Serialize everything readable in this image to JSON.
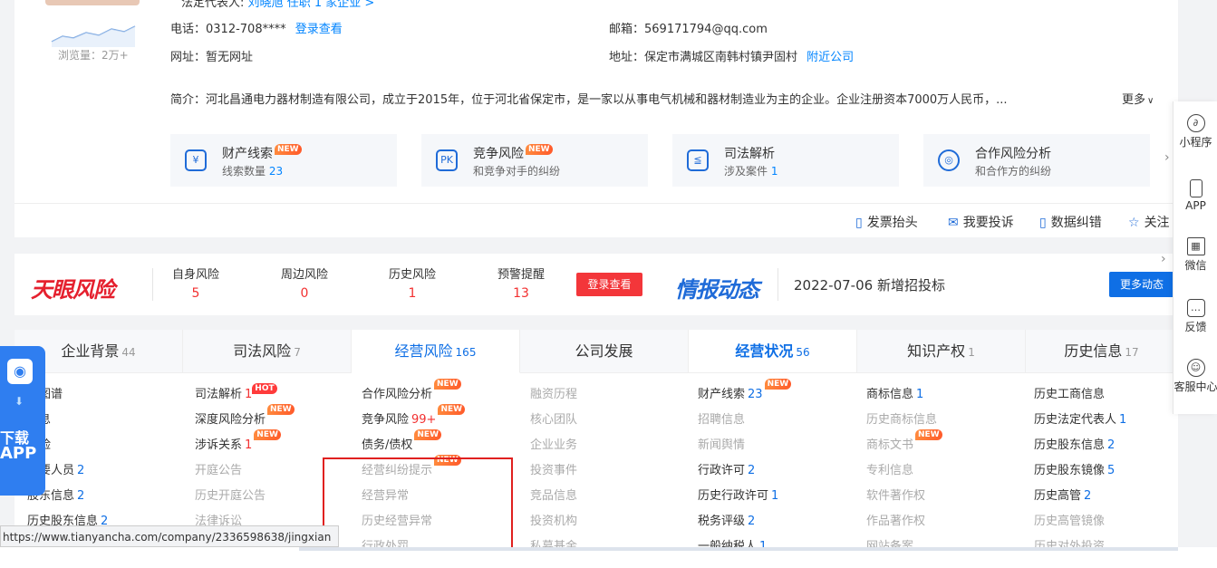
{
  "top": {
    "legal_rep_label": "法定代表人:",
    "legal_rep_name": "刘晓旭",
    "legal_rep_suffix": "任职 1 家企业 >",
    "views": "浏览量：2万+",
    "phone_label": "电话：",
    "phone": "0312-708****",
    "phone_link": "登录查看",
    "email_label": "邮箱：",
    "email": "569171794@qq.com",
    "site_label": "网址：",
    "site": "暂无网址",
    "address_label": "地址：",
    "address": "保定市满城区南韩村镇尹固村",
    "nearby_link": "附近公司",
    "intro": "简介：河北昌通电力器材制造有限公司，成立于2015年，位于河北省保定市，是一家以从事电气机械和器材制造业为主的企业。企业注册资本7000万人民币，...",
    "more": "更多",
    "features": [
      {
        "icon": "¥",
        "title": "财产线索",
        "tag": "NEW",
        "sub_prefix": "线索数量",
        "sub_num": "23"
      },
      {
        "icon": "PK",
        "title": "竞争风险",
        "tag": "NEW",
        "sub_prefix": "和竞争对手的纠纷",
        "sub_num": ""
      },
      {
        "icon": "≦",
        "title": "司法解析",
        "tag": "",
        "sub_prefix": "涉及案件",
        "sub_num": "1"
      },
      {
        "icon": "◎",
        "title": "合作风险分析",
        "tag": "",
        "sub_prefix": "和合作方的纠纷",
        "sub_num": ""
      }
    ],
    "actions": [
      "发票抬头",
      "我要投诉",
      "数据纠错",
      "关注"
    ]
  },
  "risk": {
    "logo": "天眼风险",
    "cols": [
      {
        "label": "自身风险",
        "value": "5"
      },
      {
        "label": "周边风险",
        "value": "0"
      },
      {
        "label": "历史风险",
        "value": "1"
      },
      {
        "label": "预警提醒",
        "value": "13"
      }
    ],
    "login_button": "登录查看",
    "intel_logo": "情报动态",
    "intel_text": "2022-07-06   新增招投标",
    "more_button": "更多动态"
  },
  "tabs": [
    {
      "label": "企业背景",
      "count": "44"
    },
    {
      "label": "司法风险",
      "count": "7"
    },
    {
      "label": "经营风险",
      "count": "165"
    },
    {
      "label": "公司发展",
      "count": ""
    },
    {
      "label": "经营状况",
      "count": "56"
    },
    {
      "label": "知识产权",
      "count": "1"
    },
    {
      "label": "历史信息",
      "count": "17"
    }
  ],
  "columns": [
    [
      {
        "text": "眼图谱",
        "num": "",
        "tag": ""
      },
      {
        "text": "信息",
        "num": "",
        "tag": ""
      },
      {
        "text": "风险",
        "num": "",
        "tag": ""
      },
      {
        "text": "主要人员",
        "num": "2",
        "tag": ""
      },
      {
        "text": "股东信息",
        "num": "2",
        "tag": ""
      },
      {
        "text": "历史股东信息",
        "num": "2",
        "tag": ""
      }
    ],
    [
      {
        "text": "司法解析",
        "num": "1",
        "tag": "HOT",
        "numred": true
      },
      {
        "text": "深度风险分析",
        "num": "",
        "tag": "NEW"
      },
      {
        "text": "涉诉关系",
        "num": "1",
        "tag": "NEW",
        "numred": true
      },
      {
        "text": "开庭公告",
        "num": "",
        "tag": "",
        "dim": true
      },
      {
        "text": "历史开庭公告",
        "num": "",
        "tag": "",
        "dim": true
      },
      {
        "text": "法律诉讼",
        "num": "",
        "tag": "",
        "dim": true
      }
    ],
    [
      {
        "text": "合作风险分析",
        "num": "",
        "tag": "NEW"
      },
      {
        "text": "竞争风险",
        "num": "99+",
        "tag": "NEW",
        "numred": true
      },
      {
        "text": "债务/债权",
        "num": "",
        "tag": "NEW"
      },
      {
        "text": "经营纠纷提示",
        "num": "",
        "tag": "NEW",
        "dim": true
      },
      {
        "text": "经营异常",
        "num": "",
        "tag": "",
        "dim": true
      },
      {
        "text": "历史经营异常",
        "num": "",
        "tag": "",
        "dim": true
      },
      {
        "text": "行政处罚",
        "num": "",
        "tag": "",
        "dim": true
      }
    ],
    [
      {
        "text": "融资历程",
        "num": "",
        "tag": "",
        "dim": true
      },
      {
        "text": "核心团队",
        "num": "",
        "tag": "",
        "dim": true
      },
      {
        "text": "企业业务",
        "num": "",
        "tag": "",
        "dim": true
      },
      {
        "text": "投资事件",
        "num": "",
        "tag": "",
        "dim": true
      },
      {
        "text": "竞品信息",
        "num": "",
        "tag": "",
        "dim": true
      },
      {
        "text": "投资机构",
        "num": "",
        "tag": "",
        "dim": true
      },
      {
        "text": "私募基金",
        "num": "",
        "tag": "",
        "dim": true
      }
    ],
    [
      {
        "text": "财产线索",
        "num": "23",
        "tag": "NEW"
      },
      {
        "text": "招聘信息",
        "num": "",
        "tag": "",
        "dim": true
      },
      {
        "text": "新闻舆情",
        "num": "",
        "tag": "",
        "dim": true
      },
      {
        "text": "行政许可",
        "num": "2",
        "tag": ""
      },
      {
        "text": "历史行政许可",
        "num": "1",
        "tag": ""
      },
      {
        "text": "税务评级",
        "num": "2",
        "tag": ""
      },
      {
        "text": "一般纳税人",
        "num": "1",
        "tag": ""
      }
    ],
    [
      {
        "text": "商标信息",
        "num": "1",
        "tag": ""
      },
      {
        "text": "历史商标信息",
        "num": "",
        "tag": "",
        "dim": true
      },
      {
        "text": "商标文书",
        "num": "",
        "tag": "NEW",
        "dim": true
      },
      {
        "text": "专利信息",
        "num": "",
        "tag": "",
        "dim": true
      },
      {
        "text": "软件著作权",
        "num": "",
        "tag": "",
        "dim": true
      },
      {
        "text": "作品著作权",
        "num": "",
        "tag": "",
        "dim": true
      },
      {
        "text": "网站备案",
        "num": "",
        "tag": "",
        "dim": true
      }
    ],
    [
      {
        "text": "历史工商信息",
        "num": "",
        "tag": ""
      },
      {
        "text": "历史法定代表人",
        "num": "1",
        "tag": ""
      },
      {
        "text": "历史股东信息",
        "num": "2",
        "tag": ""
      },
      {
        "text": "历史股东镜像",
        "num": "5",
        "tag": ""
      },
      {
        "text": "历史高管",
        "num": "2",
        "tag": ""
      },
      {
        "text": "历史高管镜像",
        "num": "",
        "tag": "",
        "dim": true
      },
      {
        "text": "历史对外投资",
        "num": "",
        "tag": "",
        "dim": true
      }
    ]
  ],
  "download": {
    "line1": "下载",
    "line2": "APP"
  },
  "sidebar": [
    {
      "icon": "mini-program-icon",
      "label": "小程序"
    },
    {
      "icon": "phone-icon",
      "label": "APP"
    },
    {
      "icon": "qr-code-icon",
      "label": "微信"
    },
    {
      "icon": "feedback-icon",
      "label": "反馈"
    },
    {
      "icon": "customer-service-icon",
      "label": "客服中心"
    }
  ],
  "status_url": "https://www.tianyancha.com/company/2336598638/jingxian",
  "colors": {
    "brand_blue": "#0f6fe5",
    "risk_red": "#e5202e",
    "highlight_box": "#e0201f"
  }
}
